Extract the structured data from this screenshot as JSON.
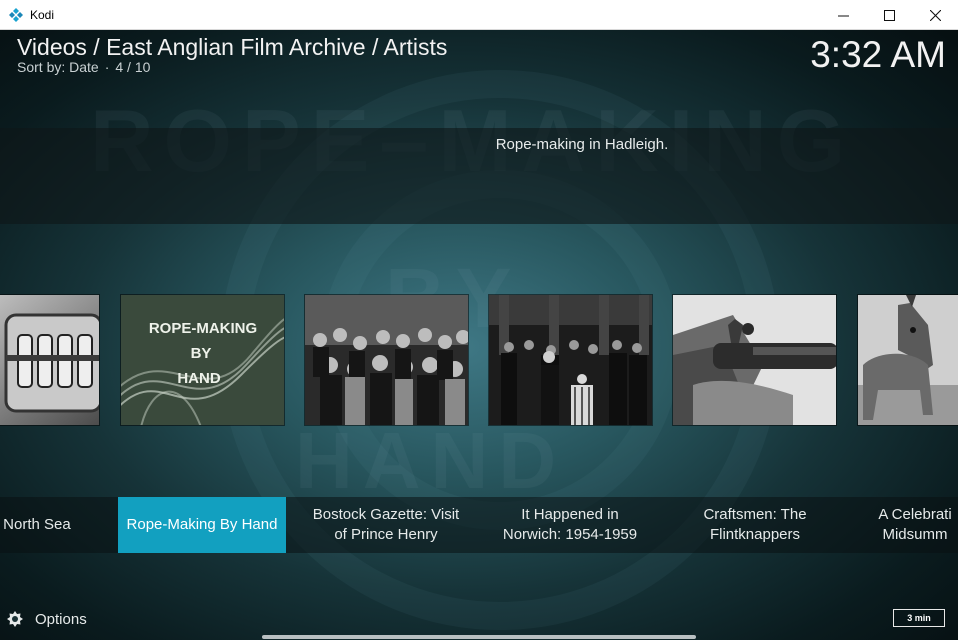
{
  "window": {
    "title": "Kodi",
    "controls": [
      "minimize",
      "maximize",
      "close"
    ]
  },
  "header": {
    "breadcrumb": "Videos / East Anglian Film Archive / Artists",
    "sort_label": "Sort by: Date",
    "position": "4 / 10",
    "clock": "3:32 AM"
  },
  "plot": "Rope-making in Hadleigh.",
  "items": [
    {
      "label": "r One, North Sea",
      "thumb_icon": "machinery-still",
      "focused": false
    },
    {
      "label": "Rope-Making By Hand",
      "thumb_icon": "title-card",
      "focused": true,
      "title_card": [
        "ROPE-MAKING",
        "BY",
        "HAND"
      ]
    },
    {
      "label": "Bostock Gazette: Visit of Prince Henry",
      "thumb_icon": "crowd-still",
      "focused": false
    },
    {
      "label": "It Happened in Norwich: 1954-1959",
      "thumb_icon": "ceremony-still",
      "focused": false
    },
    {
      "label": "Craftsmen: The Flintknappers",
      "thumb_icon": "flintlock-still",
      "focused": false
    },
    {
      "label": "A Celebrati Midsumm",
      "thumb_icon": "horse-still",
      "focused": false
    }
  ],
  "footer": {
    "options_label": "Options",
    "duration": "3 min"
  },
  "colors": {
    "focus": "#12a0c0",
    "text": "#e6eaea"
  }
}
